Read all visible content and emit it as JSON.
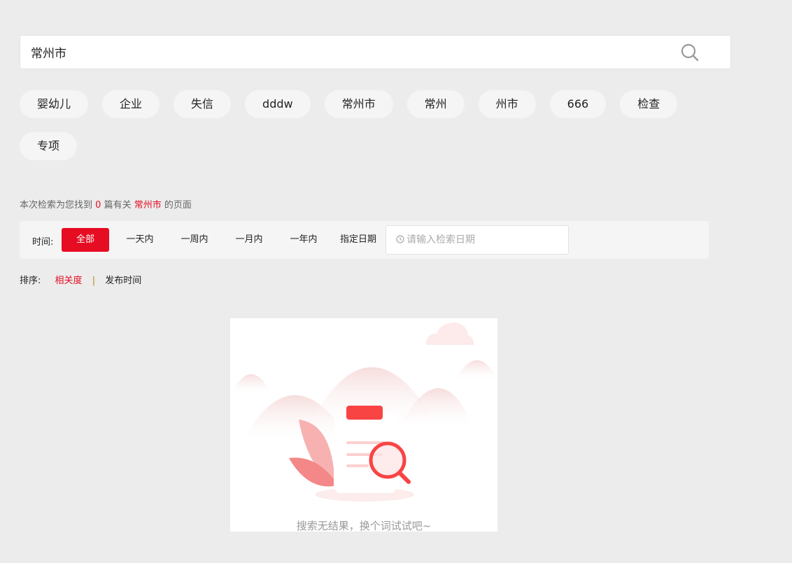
{
  "search": {
    "value": "常州市",
    "icon": "search-icon"
  },
  "tags": [
    "婴幼儿",
    "企业",
    "失信",
    "dddw",
    "常州市",
    "常州",
    "州市",
    "666",
    "检查",
    "专项"
  ],
  "summary": {
    "prefix": "本次检索为您找到",
    "count": "0",
    "middle": "篇有关",
    "keyword": "常州市",
    "suffix": "的页面"
  },
  "filter": {
    "label": "时间:",
    "options": [
      "全部",
      "一天内",
      "一周内",
      "一月内",
      "一年内"
    ],
    "active": "全部",
    "custom_label": "指定日期",
    "date_placeholder": "请输入检索日期"
  },
  "sort": {
    "label": "排序:",
    "options": [
      "相关度",
      "发布时间"
    ],
    "active": "相关度"
  },
  "empty": {
    "message": "搜索无结果，换个词试试吧~"
  },
  "colors": {
    "accent": "#e60c22",
    "background": "#ececec"
  }
}
